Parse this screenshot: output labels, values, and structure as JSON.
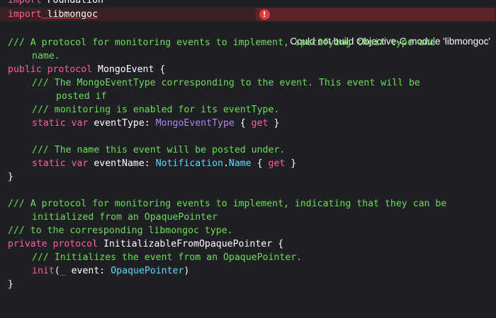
{
  "error": {
    "message": "Could not build Objective-C module 'libmongoc'",
    "icon": "error-icon"
  },
  "lines": {
    "l1": {
      "kw": "import",
      "rest": " Foundation"
    },
    "l2": {
      "kw": "import",
      "rest": " libmongoc"
    },
    "l4": "/// A protocol for monitoring events to implement, specifying their type and",
    "l5": "name.",
    "l6": {
      "kw": "public protocol",
      "rest": " MongoEvent {"
    },
    "l7": "/// The MongoEventType corresponding to the event. This event will be",
    "l8": "posted if",
    "l9": "/// monitoring is enabled for its eventType.",
    "l10": {
      "kw": "static var",
      "name": " eventType: ",
      "type": "MongoEventType",
      "brace": " { ",
      "get": "get",
      "end": " }"
    },
    "l12": "/// The name this event will be posted under.",
    "l13": {
      "kw": "static var",
      "name": " eventName: ",
      "type": "Notification",
      "dot": ".",
      "type2": "Name",
      "brace": " { ",
      "get": "get",
      "end": " }"
    },
    "l14": "}",
    "l16": "/// A protocol for monitoring events to implement, indicating that they can be",
    "l17": "initialized from an OpaquePointer",
    "l18": "/// to the corresponding libmongoc type.",
    "l19": {
      "kw": "private protocol",
      "rest": " InitializableFromOpaquePointer {"
    },
    "l20": "/// Initializes the event from an OpaquePointer.",
    "l21": {
      "kw": "init",
      "open": "(",
      "us": "_",
      "arg": " event: ",
      "type": "OpaquePointer",
      "close": ")"
    },
    "l22": "}"
  },
  "colors": {
    "background": "#1f2024",
    "keyword": "#fc5fa3",
    "comment": "#6bdd57",
    "type": "#b383e8",
    "type_system": "#5dd8ff",
    "error_line": "#3a2123",
    "error_badge": "#5c2426"
  }
}
